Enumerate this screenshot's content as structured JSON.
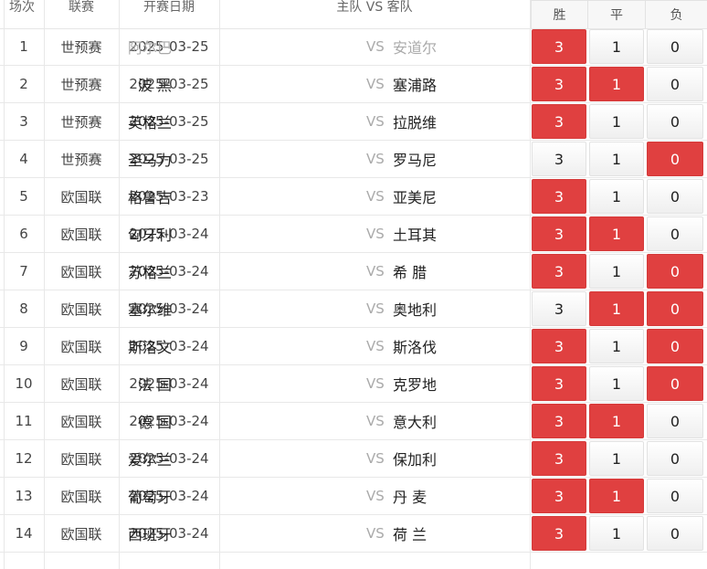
{
  "header": {
    "round": "场次",
    "league": "联赛",
    "date": "开赛日期",
    "teams": "主队 VS 客队",
    "win": "胜",
    "draw": "平",
    "loss": "负"
  },
  "colors": {
    "selected": "#e04040"
  },
  "rows": [
    {
      "no": "1",
      "league": "世预赛",
      "date": "2025-03-25",
      "home": "阿尔巴",
      "vs": "VS",
      "away": "安道尔",
      "win": "3",
      "draw": "1",
      "loss": "0",
      "sel": [
        "win"
      ],
      "dim": true
    },
    {
      "no": "2",
      "league": "世预赛",
      "date": "2025-03-25",
      "home": "波 黑",
      "vs": "VS",
      "away": "塞浦路",
      "win": "3",
      "draw": "1",
      "loss": "0",
      "sel": [
        "win",
        "draw"
      ]
    },
    {
      "no": "3",
      "league": "世预赛",
      "date": "2025-03-25",
      "home": "英格兰",
      "vs": "VS",
      "away": "拉脱维",
      "win": "3",
      "draw": "1",
      "loss": "0",
      "sel": [
        "win"
      ]
    },
    {
      "no": "4",
      "league": "世预赛",
      "date": "2025-03-25",
      "home": "圣马力",
      "vs": "VS",
      "away": "罗马尼",
      "win": "3",
      "draw": "1",
      "loss": "0",
      "sel": [
        "loss"
      ]
    },
    {
      "no": "5",
      "league": "欧国联",
      "date": "2025-03-23",
      "home": "格鲁吉",
      "vs": "VS",
      "away": "亚美尼",
      "win": "3",
      "draw": "1",
      "loss": "0",
      "sel": [
        "win"
      ]
    },
    {
      "no": "6",
      "league": "欧国联",
      "date": "2025-03-24",
      "home": "匈牙利",
      "vs": "VS",
      "away": "土耳其",
      "win": "3",
      "draw": "1",
      "loss": "0",
      "sel": [
        "win",
        "draw"
      ]
    },
    {
      "no": "7",
      "league": "欧国联",
      "date": "2025-03-24",
      "home": "苏格兰",
      "vs": "VS",
      "away": "希 腊",
      "win": "3",
      "draw": "1",
      "loss": "0",
      "sel": [
        "win",
        "loss"
      ]
    },
    {
      "no": "8",
      "league": "欧国联",
      "date": "2025-03-24",
      "home": "塞尔维",
      "vs": "VS",
      "away": "奥地利",
      "win": "3",
      "draw": "1",
      "loss": "0",
      "sel": [
        "draw",
        "loss"
      ]
    },
    {
      "no": "9",
      "league": "欧国联",
      "date": "2025-03-24",
      "home": "斯洛文",
      "vs": "VS",
      "away": "斯洛伐",
      "win": "3",
      "draw": "1",
      "loss": "0",
      "sel": [
        "win",
        "loss"
      ]
    },
    {
      "no": "10",
      "league": "欧国联",
      "date": "2025-03-24",
      "home": "法 国",
      "vs": "VS",
      "away": "克罗地",
      "win": "3",
      "draw": "1",
      "loss": "0",
      "sel": [
        "win",
        "loss"
      ]
    },
    {
      "no": "11",
      "league": "欧国联",
      "date": "2025-03-24",
      "home": "德 国",
      "vs": "VS",
      "away": "意大利",
      "win": "3",
      "draw": "1",
      "loss": "0",
      "sel": [
        "win",
        "draw"
      ]
    },
    {
      "no": "12",
      "league": "欧国联",
      "date": "2025-03-24",
      "home": "爱尔兰",
      "vs": "VS",
      "away": "保加利",
      "win": "3",
      "draw": "1",
      "loss": "0",
      "sel": [
        "win"
      ]
    },
    {
      "no": "13",
      "league": "欧国联",
      "date": "2025-03-24",
      "home": "葡萄牙",
      "vs": "VS",
      "away": "丹 麦",
      "win": "3",
      "draw": "1",
      "loss": "0",
      "sel": [
        "win",
        "draw"
      ]
    },
    {
      "no": "14",
      "league": "欧国联",
      "date": "2025-03-24",
      "home": "西班牙",
      "vs": "VS",
      "away": "荷 兰",
      "win": "3",
      "draw": "1",
      "loss": "0",
      "sel": [
        "win"
      ]
    }
  ]
}
